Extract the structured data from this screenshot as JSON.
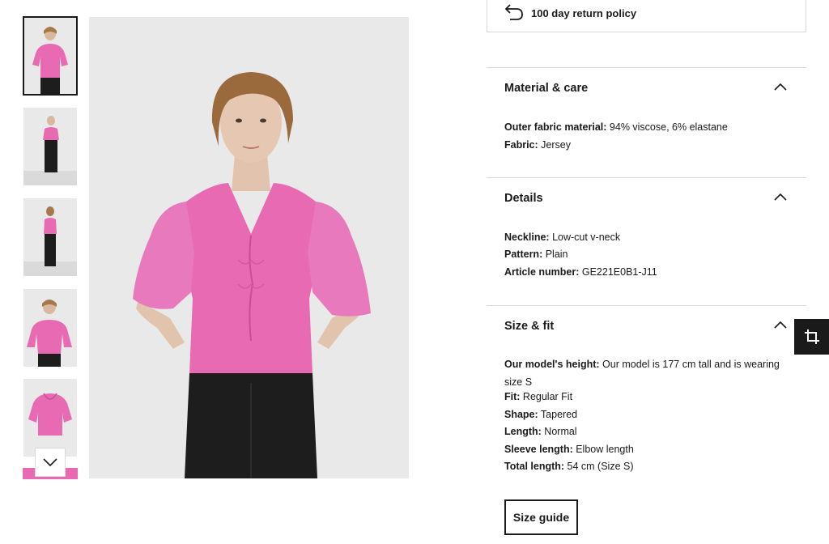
{
  "gallery": {
    "thumbnails": [
      {
        "alt": "Model front view, pink top",
        "selected": true
      },
      {
        "alt": "Full body front view"
      },
      {
        "alt": "Full body side view"
      },
      {
        "alt": "Three-quarter view"
      },
      {
        "alt": "Product only, pink top"
      }
    ],
    "scroll_down_icon": "chevron-down-icon"
  },
  "main_image": {
    "alt": "Model wearing pink v-neck top with puff sleeves and black trousers"
  },
  "returns": {
    "text": "100 day return policy",
    "icon": "return-arrow-icon"
  },
  "sections": {
    "material": {
      "title": "Material & care",
      "rows": [
        {
          "label": "Outer fabric material:",
          "value": " 94% viscose, 6% elastane"
        },
        {
          "label": "Fabric:",
          "value": " Jersey"
        }
      ]
    },
    "details": {
      "title": "Details",
      "rows": [
        {
          "label": "Neckline:",
          "value": " Low-cut v-neck"
        },
        {
          "label": "Pattern:",
          "value": " Plain"
        },
        {
          "label": "Article number:",
          "value": " GE221E0B1-J11"
        }
      ]
    },
    "size_fit": {
      "title": "Size & fit",
      "rows": [
        {
          "label": "Our model's height:",
          "value": " Our model is 177 cm tall and is wearing size S"
        },
        {
          "label": "Fit:",
          "value": " Regular Fit"
        },
        {
          "label": "Shape:",
          "value": " Tapered"
        },
        {
          "label": "Length:",
          "value": " Normal"
        },
        {
          "label": "Sleeve length:",
          "value": " Elbow length"
        },
        {
          "label": "Total length:",
          "value": " 54 cm (Size S)"
        }
      ]
    }
  },
  "size_guide_label": "Size guide",
  "floating_button_icon": "crop-icon",
  "colors": {
    "product_pink": "#e86ab3",
    "text": "#1a1a1a",
    "border": "#d9d9d9",
    "image_bg": "#e9e9e9"
  }
}
